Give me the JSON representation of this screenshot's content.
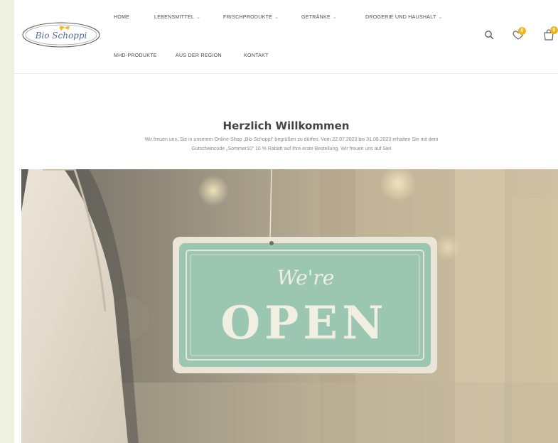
{
  "brand": {
    "logo_text": "Bio Schoppi"
  },
  "nav": {
    "row1": [
      {
        "label": "HOME",
        "has_dropdown": false
      },
      {
        "label": "LEBENSMITTEL",
        "has_dropdown": true
      },
      {
        "label": "FRISCHPRODUKTE",
        "has_dropdown": true
      },
      {
        "label": "GETRÄNKE",
        "has_dropdown": true
      },
      {
        "label": "DROGERIE UND HAUSHALT",
        "has_dropdown": true
      }
    ],
    "row2": [
      {
        "label": "MHD-PRODUKTE"
      },
      {
        "label": "AUS DER REGION"
      },
      {
        "label": "KONTAKT"
      }
    ],
    "caret": "⌄"
  },
  "header_icons": {
    "search": "search-icon",
    "wishlist": "heart-icon",
    "wishlist_count": "0",
    "cart": "cart-icon",
    "cart_count": "0"
  },
  "welcome": {
    "title_light": "Herzlich ",
    "title_bold": "Willkommen",
    "text": "Wir freuen uns, Sie in unserem Online-Shop „Bio Schoppi“ begrüßen zu dürfen. Vom 22.07.2023 bis 31.08.2023 erhalten Sie mit dem Gutscheincode „Sommer10“ 10 % Rabatt auf Ihre erste Bestellung. Wir freuen uns auf Sie!"
  },
  "hero": {
    "sign_script": "We're",
    "sign_main": "OPEN"
  },
  "colors": {
    "accent": "#f3b51b",
    "sign_green": "#8dbfa8",
    "page_bg": "#eef0e2"
  }
}
